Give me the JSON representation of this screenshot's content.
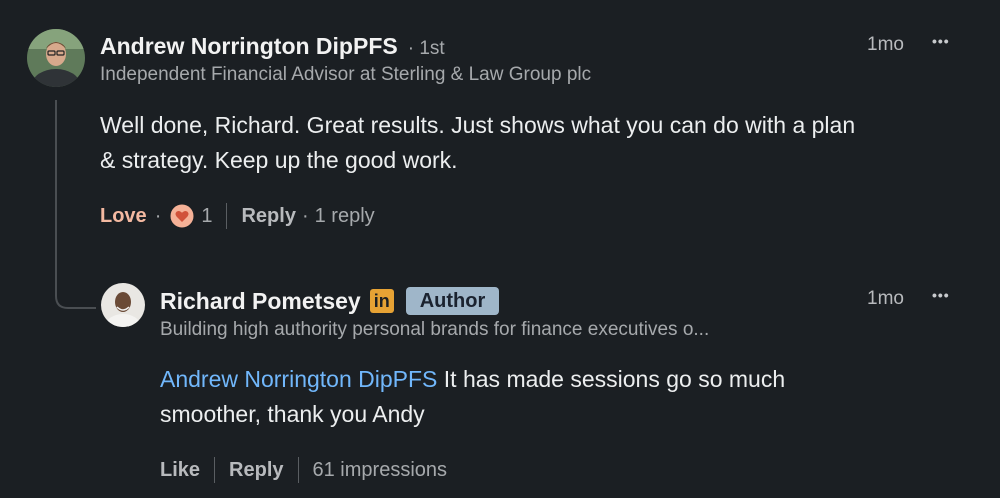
{
  "comment": {
    "author_name": "Andrew Norrington DipPFS",
    "degree": "· 1st",
    "headline": "Independent Financial Advisor at Sterling & Law Group plc",
    "time": "1mo",
    "more": "•••",
    "text_line1": "Well done, Richard. Great results. Just shows what you can do with a plan",
    "text_line2": "& strategy. Keep up the good work.",
    "actions": {
      "reaction_label": "Love",
      "dot1": "·",
      "reaction_count": "1",
      "reply_label": "Reply",
      "dot2": "·",
      "reply_count": "1 reply"
    }
  },
  "reply": {
    "author_name": "Richard Pometsey",
    "in_badge": "in",
    "author_badge": "Author",
    "headline": "Building high authority personal brands for finance executives o...",
    "time": "1mo",
    "more": "•••",
    "mention": "Andrew Norrington DipPFS",
    "text_line1_rest": " It has made sessions go so much",
    "text_line2": "smoother, thank you Andy",
    "actions": {
      "like_label": "Like",
      "reply_label": "Reply",
      "impressions": "61 impressions"
    }
  },
  "colors": {
    "background": "#1b1f23",
    "mention": "#71b7fb",
    "love": "#f4b9a1",
    "author_badge": "#9fb6c9",
    "in_badge": "#e6a234"
  }
}
